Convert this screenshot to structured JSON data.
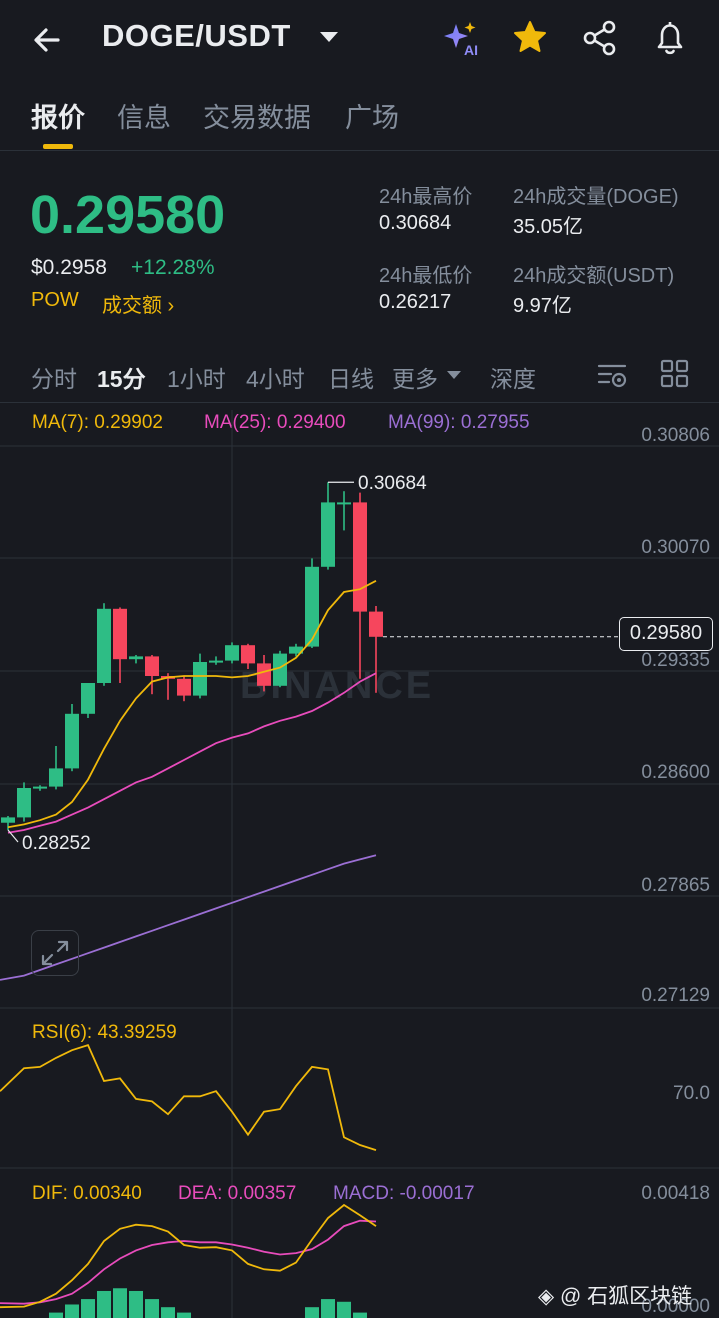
{
  "header": {
    "pair": "DOGE/USDT",
    "icons": [
      "back-arrow-icon",
      "chevron-down-icon",
      "ai-sparkle-icon",
      "star-icon",
      "share-icon",
      "bell-icon"
    ],
    "ai_badge": "AI"
  },
  "tabs": [
    {
      "label": "报价",
      "active": true
    },
    {
      "label": "信息",
      "active": false
    },
    {
      "label": "交易数据",
      "active": false
    },
    {
      "label": "广场",
      "active": false
    }
  ],
  "ticker": {
    "last_price": "0.29580",
    "usd_price": "$0.2958",
    "change": "+12.28%",
    "tag": "POW",
    "volume_link": "成交额 ›"
  },
  "stats": {
    "high_label": "24h最高价",
    "high_value": "0.30684",
    "low_label": "24h最低价",
    "low_value": "0.26217",
    "vol_base_label": "24h成交量(DOGE)",
    "vol_base_value": "35.05亿",
    "vol_quote_label": "24h成交额(USDT)",
    "vol_quote_value": "9.97亿"
  },
  "intervals": [
    {
      "label": "分时",
      "active": false
    },
    {
      "label": "15分",
      "active": true
    },
    {
      "label": "1小时",
      "active": false
    },
    {
      "label": "4小时",
      "active": false
    },
    {
      "label": "日线",
      "active": false
    },
    {
      "label": "更多",
      "active": false
    },
    {
      "label": "深度",
      "active": false
    }
  ],
  "chart_icons": [
    "chart-settings-icon",
    "layout-grid-icon",
    "expand-icon"
  ],
  "ma": {
    "ma7": "MA(7): 0.29902",
    "ma25": "MA(25): 0.29400",
    "ma99": "MA(99): 0.27955"
  },
  "colors": {
    "up": "#2ebd85",
    "down": "#f6465d",
    "ma7": "#f0b90b",
    "ma25": "#e84cbc",
    "ma99": "#9b6fd4",
    "brand": "#f0b90b"
  },
  "price_axis": [
    "0.30806",
    "0.30070",
    "0.29335",
    "0.28600",
    "0.27865",
    "0.27129"
  ],
  "current_price_tag": "0.29580",
  "high_marker": "0.30684",
  "low_marker": "0.28252",
  "chart_watermark": "BINANCE",
  "rsi": {
    "label": "RSI(6): 43.39259",
    "axis": "70.0"
  },
  "macd": {
    "dif": "DIF: 0.00340",
    "dea": "DEA: 0.00357",
    "macd": "MACD: -0.00017",
    "axis_top": "0.00418",
    "axis_bottom": "0.00000"
  },
  "footer_watermark": "@ 石狐区块链",
  "chart_data": {
    "type": "candlestick",
    "candles": [
      {
        "o": 0.28252,
        "h": 0.283,
        "l": 0.282,
        "c": 0.2829
      },
      {
        "o": 0.2829,
        "h": 0.2854,
        "l": 0.2826,
        "c": 0.285
      },
      {
        "o": 0.285,
        "h": 0.2852,
        "l": 0.2848,
        "c": 0.2851
      },
      {
        "o": 0.2851,
        "h": 0.288,
        "l": 0.2849,
        "c": 0.2864
      },
      {
        "o": 0.2864,
        "h": 0.291,
        "l": 0.2862,
        "c": 0.2903
      },
      {
        "o": 0.2903,
        "h": 0.2925,
        "l": 0.29,
        "c": 0.2925
      },
      {
        "o": 0.2925,
        "h": 0.2982,
        "l": 0.2923,
        "c": 0.2978
      },
      {
        "o": 0.2978,
        "h": 0.2979,
        "l": 0.2925,
        "c": 0.2942
      },
      {
        "o": 0.2942,
        "h": 0.2945,
        "l": 0.2939,
        "c": 0.2944
      },
      {
        "o": 0.2944,
        "h": 0.2945,
        "l": 0.2917,
        "c": 0.293
      },
      {
        "o": 0.293,
        "h": 0.2932,
        "l": 0.2913,
        "c": 0.2928
      },
      {
        "o": 0.2928,
        "h": 0.293,
        "l": 0.2912,
        "c": 0.2916
      },
      {
        "o": 0.2916,
        "h": 0.2946,
        "l": 0.2914,
        "c": 0.294
      },
      {
        "o": 0.294,
        "h": 0.2944,
        "l": 0.2938,
        "c": 0.2941
      },
      {
        "o": 0.2941,
        "h": 0.2954,
        "l": 0.2939,
        "c": 0.2952
      },
      {
        "o": 0.2952,
        "h": 0.2953,
        "l": 0.2935,
        "c": 0.2939
      },
      {
        "o": 0.2939,
        "h": 0.2945,
        "l": 0.2919,
        "c": 0.2923
      },
      {
        "o": 0.2923,
        "h": 0.2948,
        "l": 0.2922,
        "c": 0.2946
      },
      {
        "o": 0.2946,
        "h": 0.2953,
        "l": 0.2944,
        "c": 0.2951
      },
      {
        "o": 0.2951,
        "h": 0.3014,
        "l": 0.295,
        "c": 0.3008
      },
      {
        "o": 0.3008,
        "h": 0.30684,
        "l": 0.3006,
        "c": 0.3054
      },
      {
        "o": 0.3054,
        "h": 0.3062,
        "l": 0.3034,
        "c": 0.3054
      },
      {
        "o": 0.3054,
        "h": 0.3061,
        "l": 0.2928,
        "c": 0.2976
      },
      {
        "o": 0.2976,
        "h": 0.298,
        "l": 0.2918,
        "c": 0.2958
      }
    ],
    "ma7": [
      0.2822,
      0.2824,
      0.2827,
      0.2831,
      0.284,
      0.2856,
      0.2878,
      0.2898,
      0.2914,
      0.2926,
      0.2929,
      0.293,
      0.293,
      0.293,
      0.2929,
      0.293,
      0.2933,
      0.2936,
      0.2943,
      0.2956,
      0.2977,
      0.299,
      0.2992,
      0.2998
    ],
    "ma25": [
      0.2818,
      0.282,
      0.2823,
      0.2826,
      0.2831,
      0.2836,
      0.2842,
      0.2848,
      0.2854,
      0.2858,
      0.2864,
      0.287,
      0.2876,
      0.2882,
      0.2886,
      0.2889,
      0.2894,
      0.2898,
      0.2901,
      0.2905,
      0.2911,
      0.2918,
      0.2926,
      0.2932
    ],
    "ma99": [
      0.27129,
      0.2716,
      0.272,
      0.2724,
      0.2728,
      0.2732,
      0.2736,
      0.274,
      0.2744,
      0.2748,
      0.2752,
      0.2756,
      0.276,
      0.2764,
      0.2768,
      0.2772,
      0.2776,
      0.278,
      0.2784,
      0.2788,
      0.2792,
      0.2796,
      0.2799,
      0.2802
    ],
    "ylim": [
      0.2695,
      0.312
    ],
    "rsi6": [
      60,
      78,
      79,
      86,
      92,
      96,
      68,
      70,
      54,
      52,
      42,
      56,
      56,
      60,
      44,
      26,
      44,
      46,
      64,
      79,
      77,
      24,
      18,
      14
    ],
    "rsi_ylim": [
      0,
      100
    ],
    "dif": [
      0.0004,
      0.00042,
      0.0006,
      0.0009,
      0.0014,
      0.002,
      0.00285,
      0.0033,
      0.00345,
      0.0034,
      0.0032,
      0.0027,
      0.0026,
      0.00262,
      0.0025,
      0.002,
      0.0018,
      0.00175,
      0.00205,
      0.0029,
      0.0037,
      0.00418,
      0.0038,
      0.0034
    ],
    "dea": [
      0.00055,
      0.00053,
      0.00058,
      0.0007,
      0.0009,
      0.0013,
      0.0018,
      0.0022,
      0.0025,
      0.0027,
      0.0028,
      0.00285,
      0.0028,
      0.0028,
      0.00272,
      0.0026,
      0.00245,
      0.00235,
      0.0024,
      0.00255,
      0.0029,
      0.0034,
      0.0036,
      0.00357
    ],
    "macd_hist": [
      0.0,
      0.0,
      0.0,
      0.0002,
      0.0005,
      0.0007,
      0.001,
      0.0011,
      0.001,
      0.0007,
      0.0004,
      0.0002,
      0.0,
      0.0,
      0.0,
      0.0,
      0.0,
      0.0,
      0.0,
      0.0004,
      0.0007,
      0.0006,
      0.0002,
      -0.0001
    ],
    "macd_ylim": [
      0.0,
      0.00418
    ]
  }
}
